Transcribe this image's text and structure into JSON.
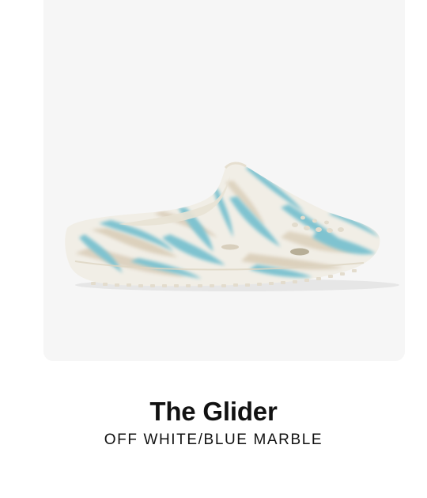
{
  "product": {
    "name": "The Glider",
    "variant": "OFF WHITE/BLUE MARBLE",
    "image_icon": "marbled-slide-clog-shoe",
    "colors": {
      "tile_background": "#f6f6f6",
      "shoe_base": "#f1eee6",
      "marble_blue": "#7fc3d0",
      "marble_beige": "#d9cdb8",
      "text": "#111111"
    }
  }
}
